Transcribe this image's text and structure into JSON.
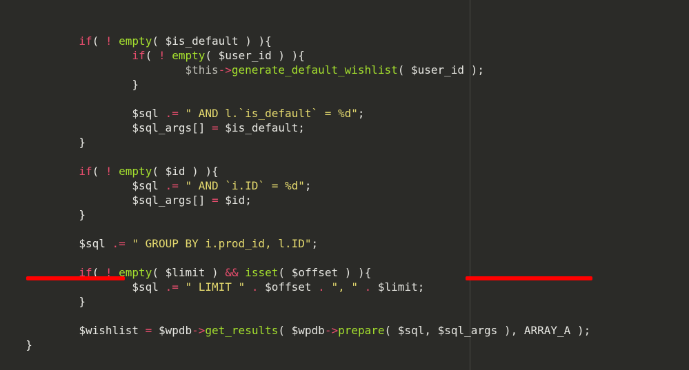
{
  "tokens": {
    "if": "if",
    "bang": "!",
    "empty": "empty",
    "isset": "isset",
    "ampamp": "&&",
    "arrow": "->",
    "dot": ".",
    "dotEq": ".=",
    "eq": "=",
    "semi": ";",
    "comma": ",",
    "lparen": "(",
    "rparen": ")",
    "lbrace": "{",
    "rbrace": "}",
    "lbracket": "[",
    "rbracket": "]"
  },
  "vars": {
    "is_default": "$is_default",
    "user_id": "$user_id",
    "this": "$this",
    "sql": "$sql",
    "sql_args": "$sql_args",
    "id": "$id",
    "limit": "$limit",
    "offset": "$offset",
    "wishlist": "$wishlist",
    "wpdb": "$wpdb"
  },
  "funcs": {
    "generate_default_wishlist": "generate_default_wishlist",
    "get_results": "get_results",
    "prepare": "prepare"
  },
  "strings": {
    "and_is_default": "\" AND l.`is_default` = %d\"",
    "and_iid": "\" AND `i.ID` = %d\"",
    "group_by": "\" GROUP BY i.prod_id, l.ID\"",
    "limit_kw": "\" LIMIT \"",
    "comma_sp": "\", \""
  },
  "consts": {
    "ARRAY_A": "ARRAY_A"
  }
}
